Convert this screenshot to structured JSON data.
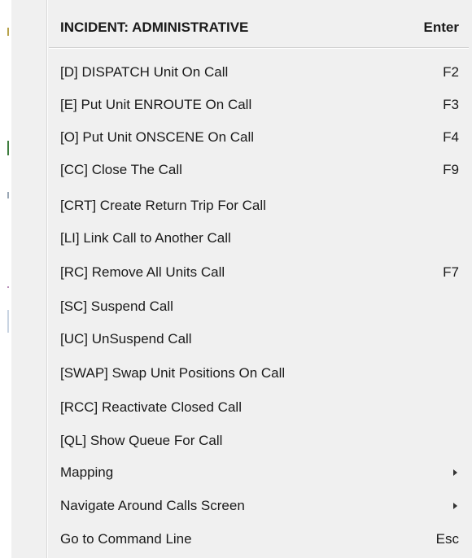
{
  "menu": {
    "header": {
      "label": "INCIDENT: ADMINISTRATIVE",
      "shortcut": "Enter"
    },
    "items": [
      {
        "label": "[D] DISPATCH Unit On Call",
        "shortcut": "F2"
      },
      {
        "label": "[E] Put Unit ENROUTE On Call",
        "shortcut": "F3"
      },
      {
        "label": "[O] Put Unit ONSCENE On Call",
        "shortcut": "F4"
      },
      {
        "label": "[CC] Close The Call",
        "shortcut": "F9"
      },
      {
        "label": "[CRT] Create Return Trip For Call",
        "shortcut": ""
      },
      {
        "label": "[LI] Link Call to Another Call",
        "shortcut": ""
      },
      {
        "label": "[RC] Remove All Units Call",
        "shortcut": "F7"
      },
      {
        "label": "[SC] Suspend Call",
        "shortcut": ""
      },
      {
        "label": "[UC] UnSuspend Call",
        "shortcut": ""
      },
      {
        "label": "[SWAP] Swap Unit Positions On Call",
        "shortcut": ""
      },
      {
        "label": "[RCC] Reactivate Closed Call",
        "shortcut": ""
      },
      {
        "label": "[QL] Show Queue For Call",
        "shortcut": ""
      },
      {
        "label": "Mapping",
        "shortcut": "",
        "submenu": true,
        "icon": "chevron-right-icon"
      },
      {
        "label": "Navigate Around Calls Screen",
        "shortcut": "",
        "submenu": true,
        "icon": "chevron-right-icon"
      },
      {
        "label": "Go to Command Line",
        "shortcut": "Esc"
      }
    ]
  }
}
